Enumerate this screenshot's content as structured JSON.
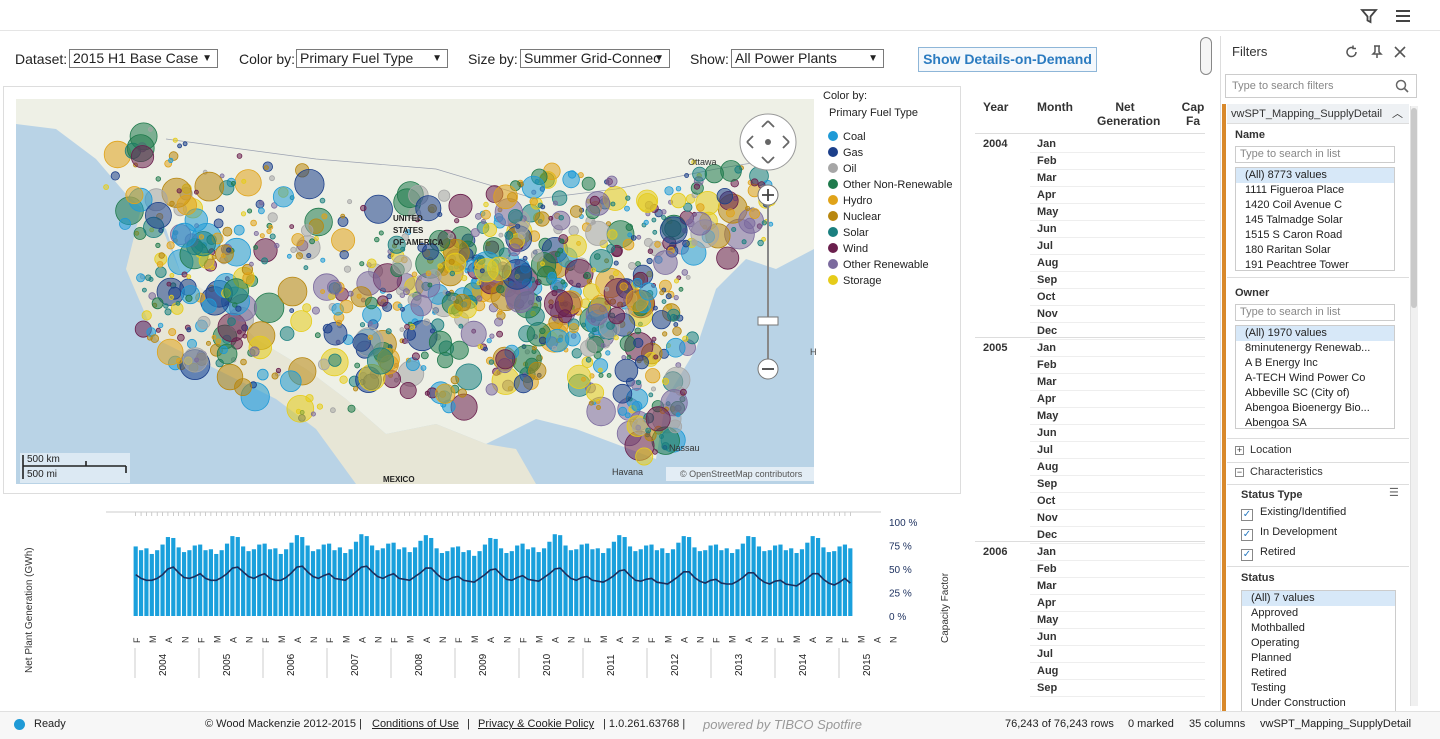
{
  "topbar": {
    "icons": [
      "filter-icon",
      "menu-icon"
    ]
  },
  "controls": {
    "dataset_label": "Dataset:",
    "dataset_value": "2015 H1 Base Case",
    "colorby_label": "Color by:",
    "colorby_value": "Primary Fuel Type",
    "sizeby_label": "Size by:",
    "sizeby_value": "Summer Grid-Connec",
    "show_label": "Show:",
    "show_value": "All Power Plants",
    "details_button": "Show Details-on-Demand"
  },
  "map": {
    "labels": {
      "ottawa": "Ottawa",
      "us": "UNITED\nSTATES\nOF AMERICA",
      "us1": "UNITED",
      "us2": "STATES",
      "us3": "OF AMERICA",
      "mexico": "MEXICO",
      "nassau": "Nassau",
      "havana": "Havana",
      "attribution": "© OpenStreetMap contributors",
      "scale_km": "500 km",
      "scale_mi": "500 mi",
      "edge_h": "H"
    },
    "legend": {
      "title": "Color by:",
      "subtitle": "Primary Fuel Type",
      "items": [
        {
          "label": "Coal",
          "color": "#1f9ad6"
        },
        {
          "label": "Gas",
          "color": "#1c3f8a"
        },
        {
          "label": "Oil",
          "color": "#a6a6a6"
        },
        {
          "label": "Other Non-Renewable",
          "color": "#1f7a4c"
        },
        {
          "label": "Hydro",
          "color": "#e0a319"
        },
        {
          "label": "Nuclear",
          "color": "#b8870f"
        },
        {
          "label": "Solar",
          "color": "#1a7f7f"
        },
        {
          "label": "Wind",
          "color": "#6a1f4d"
        },
        {
          "label": "Other Renewable",
          "color": "#7b6a9e"
        },
        {
          "label": "Storage",
          "color": "#e6cc1a"
        }
      ]
    }
  },
  "chart_data": {
    "type": "bar",
    "ylabel": "Net Plant Generation (GWh)",
    "y2label": "Capacity Factor",
    "y2_ticks": [
      "100 %",
      "75 %",
      "50 %",
      "25 %",
      "0 %"
    ],
    "month_ticks": [
      "F",
      "M",
      "A",
      "N",
      "F",
      "M",
      "A",
      "N",
      "F",
      "M",
      "A",
      "N",
      "F",
      "M",
      "A",
      "N",
      "F",
      "M",
      "A",
      "N",
      "F",
      "M",
      "A",
      "N",
      "F",
      "M",
      "A",
      "N",
      "F",
      "M",
      "A",
      "N",
      "F",
      "M",
      "A",
      "N",
      "F",
      "M",
      "A",
      "N",
      "F",
      "M",
      "A",
      "N",
      "F",
      "M",
      "A",
      "N"
    ],
    "years": [
      "2004",
      "2005",
      "2006",
      "2007",
      "2008",
      "2009",
      "2010",
      "2011",
      "2012",
      "2013",
      "2014",
      "2015"
    ],
    "series": [
      {
        "name": "Net Plant Generation",
        "values": [
          74,
          70,
          72,
          66,
          70,
          76,
          84,
          83,
          73,
          68,
          70,
          75,
          76,
          70,
          71,
          66,
          70,
          77,
          85,
          84,
          74,
          69,
          71,
          76,
          77,
          71,
          72,
          66,
          71,
          78,
          86,
          84,
          75,
          69,
          71,
          76,
          77,
          70,
          73,
          67,
          71,
          79,
          87,
          85,
          75,
          70,
          72,
          77,
          78,
          71,
          73,
          68,
          73,
          80,
          86,
          83,
          72,
          67,
          69,
          73,
          74,
          68,
          70,
          64,
          69,
          76,
          83,
          82,
          72,
          67,
          69,
          75,
          77,
          71,
          73,
          68,
          72,
          79,
          87,
          86,
          75,
          70,
          71,
          76,
          77,
          71,
          72,
          67,
          72,
          79,
          86,
          84,
          74,
          69,
          71,
          75,
          76,
          70,
          72,
          67,
          71,
          78,
          85,
          84,
          73,
          69,
          70,
          75,
          76,
          70,
          72,
          67,
          71,
          77,
          85,
          84,
          74,
          69,
          70,
          75,
          76,
          70,
          72,
          67,
          71,
          78,
          85,
          83,
          73,
          68,
          69,
          74,
          76,
          72
        ]
      },
      {
        "name": "Capacity Factor",
        "values": [
          44,
          40,
          38,
          38,
          40,
          44,
          50,
          52,
          46,
          41,
          40,
          42,
          45,
          40,
          38,
          38,
          41,
          45,
          51,
          52,
          47,
          42,
          40,
          43,
          45,
          40,
          38,
          38,
          41,
          46,
          52,
          53,
          47,
          42,
          40,
          43,
          45,
          40,
          39,
          38,
          42,
          47,
          52,
          53,
          47,
          42,
          40,
          43,
          45,
          40,
          39,
          38,
          42,
          46,
          51,
          51,
          45,
          40,
          38,
          41,
          42,
          38,
          37,
          36,
          40,
          44,
          49,
          50,
          44,
          39,
          38,
          41,
          43,
          39,
          38,
          37,
          41,
          45,
          50,
          51,
          45,
          40,
          38,
          41,
          42,
          38,
          37,
          36,
          39,
          43,
          48,
          49,
          43,
          38,
          37,
          39,
          40,
          36,
          35,
          34,
          38,
          42,
          47,
          47,
          41,
          37,
          35,
          38,
          39,
          35,
          34,
          34,
          37,
          41,
          46,
          46,
          40,
          36,
          34,
          37,
          38,
          34,
          33,
          32,
          36,
          40,
          45,
          45,
          39,
          35,
          33,
          36,
          40,
          35
        ]
      }
    ],
    "y2lim": [
      0,
      100
    ]
  },
  "table": {
    "headers": [
      "Year",
      "Month",
      "Net\nGeneration",
      "Cap\nFa"
    ],
    "header_year": "Year",
    "header_month": "Month",
    "header_net1": "Net",
    "header_net2": "Generation",
    "header_cap1": "Cap",
    "header_cap2": "Fa",
    "groups": [
      {
        "year": "2004",
        "months": [
          "Jan",
          "Feb",
          "Mar",
          "Apr",
          "May",
          "Jun",
          "Jul",
          "Aug",
          "Sep",
          "Oct",
          "Nov",
          "Dec"
        ]
      },
      {
        "year": "2005",
        "months": [
          "Jan",
          "Feb",
          "Mar",
          "Apr",
          "May",
          "Jun",
          "Jul",
          "Aug",
          "Sep",
          "Oct",
          "Nov",
          "Dec"
        ]
      },
      {
        "year": "2006",
        "months": [
          "Jan",
          "Feb",
          "Mar",
          "Apr",
          "May",
          "Jun",
          "Jul",
          "Aug",
          "Sep"
        ]
      }
    ]
  },
  "filters": {
    "title": "Filters",
    "search_placeholder": "Type to search filters",
    "group": "vwSPT_Mapping_SupplyDetail",
    "name": {
      "heading": "Name",
      "search": "Type to search in list",
      "items": [
        "(All) 8773 values",
        "1111 Figueroa Place",
        "1420 Coil Avenue C",
        "145 Talmadge Solar",
        "1515 S Caron Road",
        "180 Raritan Solar",
        "191 Peachtree Tower"
      ]
    },
    "owner": {
      "heading": "Owner",
      "search": "Type to search in list",
      "items": [
        "(All) 1970 values",
        "8minutenergy Renewab...",
        "A B Energy Inc",
        "A-TECH Wind Power Co",
        "Abbeville SC (City of)",
        "Abengoa Bioenergy Bio...",
        "Abengoa SA"
      ]
    },
    "location": "Location",
    "characteristics": "Characteristics",
    "status_type": {
      "heading": "Status Type",
      "items": [
        {
          "label": "Existing/Identified",
          "checked": true
        },
        {
          "label": "In Development",
          "checked": true
        },
        {
          "label": "Retired",
          "checked": true
        }
      ]
    },
    "status": {
      "heading": "Status",
      "items": [
        "(All) 7 values",
        "Approved",
        "Mothballed",
        "Operating",
        "Planned",
        "Retired",
        "Testing",
        "Under Construction"
      ]
    }
  },
  "statusbar": {
    "ready": "Ready",
    "copyright": "© Wood Mackenzie 2012-2015  |",
    "conditions": "Conditions of Use",
    "sep1": "|",
    "privacy": "Privacy & Cookie Policy",
    "version": "|  1.0.261.63768  |",
    "powered": "powered by TIBCO Spotfire",
    "rows": "76,243 of 76,243 rows",
    "marked": "0 marked",
    "columns": "35 columns",
    "table": "vwSPT_Mapping_SupplyDetail"
  }
}
